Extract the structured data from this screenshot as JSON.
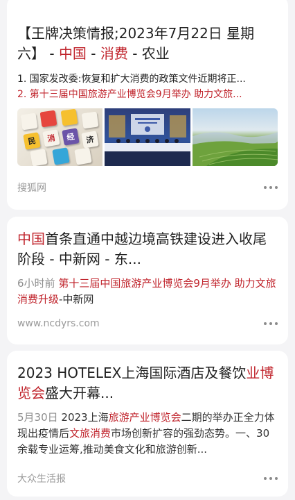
{
  "cards": [
    {
      "title_parts": [
        "【王牌决策情报;2023年7月22日 星期六】 - ",
        "中国",
        " - ",
        "消费",
        " - 农业"
      ],
      "lines": [
        {
          "text": "1. 国家发改委:恢复和扩大消费的政策文件近期将正..."
        },
        {
          "text": "2. 第十三届中国旅游产业博览会9月举办 助力文旅..."
        }
      ],
      "thumbs": [
        {
          "icon": "word-tiles-image",
          "tiles": [
            "民",
            "消",
            "经",
            "济"
          ]
        },
        {
          "icon": "conference-image"
        },
        {
          "icon": "landscape-image"
        }
      ],
      "source": "搜狐网"
    },
    {
      "title_parts": [
        "中国",
        "首条直通中越边境高铁建设进入收尾阶段 - 中新网 - 东..."
      ],
      "time": "6小时前",
      "snippet": "第十三届中国旅游产业博览会9月举办 助力文旅消费升级",
      "snippet_suffix": "-中新网",
      "source": "www.ncdyrs.com"
    },
    {
      "title_parts": [
        "2023 HOTELEX上海国际酒店及餐饮",
        "业博览会",
        "盛大开幕..."
      ],
      "date": "5月30日",
      "body_parts": [
        "2023上海",
        "旅游产业博览会",
        "二期的举办正全力体现出疫情后",
        "文旅消费",
        "市场创新扩容的强劲态势。一、30余载专业运筹,推动美食文化和旅游创新..."
      ],
      "source": "大众生活报"
    }
  ],
  "colors": {
    "accent": "#c0242c",
    "background": "#f4f4f6",
    "card": "#ffffff"
  }
}
